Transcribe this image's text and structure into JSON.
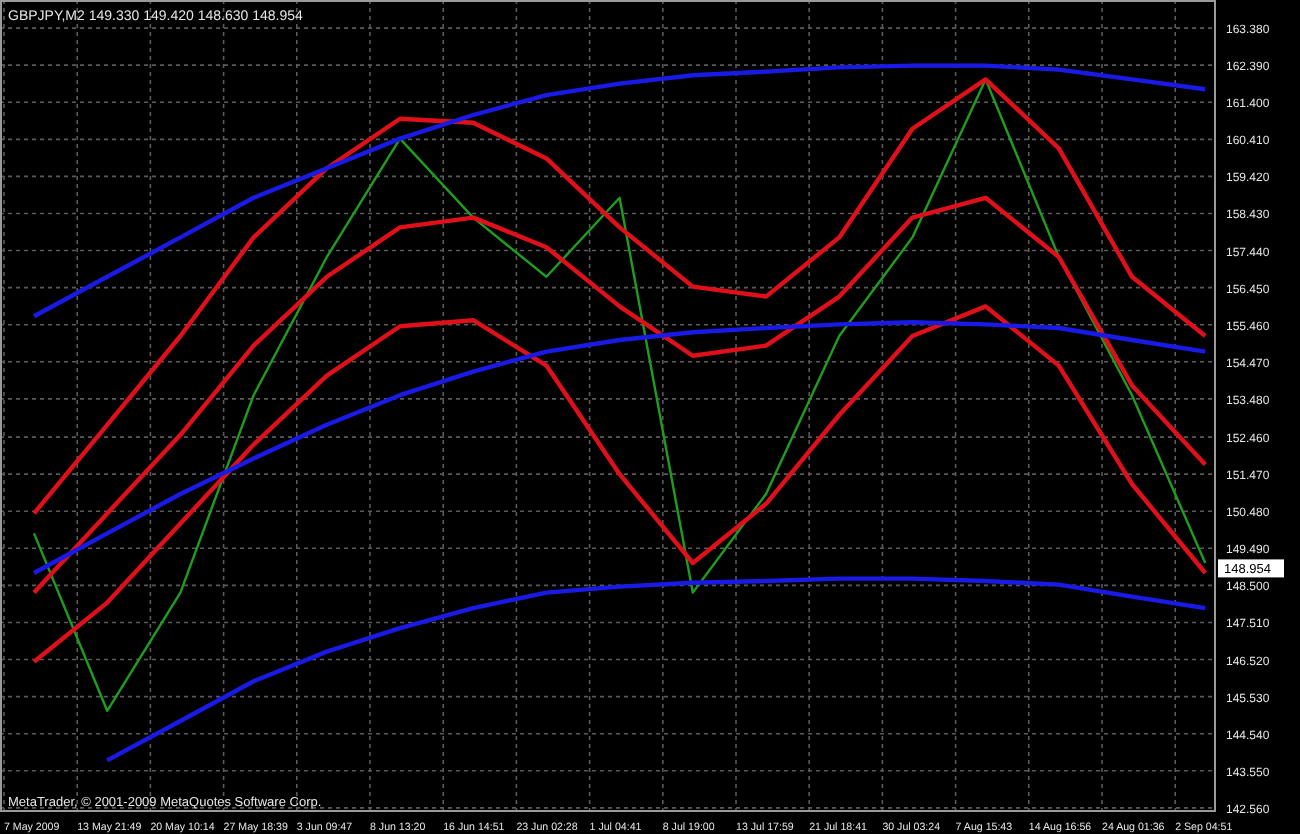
{
  "chart": {
    "title": "GBPJPY,M2 149.330 149.420 148.630 148.954",
    "copyright": "MetaTrader, © 2001-2009 MetaQuotes Software Corp.",
    "current_price": "148.954",
    "chart_data": {
      "type": "line",
      "grid": true,
      "categories": [
        "7 May 2009",
        "13 May 21:49",
        "20 May 10:14",
        "27 May 18:39",
        "3 Jun 09:47",
        "8 Jun 13:20",
        "16 Jun 14:51",
        "23 Jun 02:28",
        "1 Jul 04:41",
        "8 Jul 19:00",
        "13 Jul 17:59",
        "21 Jul 18:41",
        "30 Jul 03:24",
        "7 Aug 15:43",
        "14 Aug 16:56",
        "24 Aug 01:36",
        "2 Sep 04:51"
      ],
      "series": [
        {
          "color": "#1e9e1e",
          "values": [
            149.89,
            145.15,
            148.31,
            153.58,
            157.27,
            160.43,
            158.32,
            156.74,
            158.85,
            148.31,
            150.94,
            155.16,
            157.79,
            162.01,
            157.27,
            153.58,
            149.1
          ]
        },
        {
          "color": "#e0101a",
          "values": [
            150.42,
            152.79,
            155.16,
            157.79,
            159.64,
            160.96,
            160.85,
            159.9,
            158.06,
            156.48,
            156.21,
            157.79,
            160.69,
            162.01,
            160.17,
            156.74,
            155.16
          ]
        },
        {
          "color": "#e0101a",
          "values": [
            148.31,
            150.42,
            152.52,
            154.9,
            156.74,
            158.06,
            158.32,
            157.53,
            155.95,
            154.63,
            154.9,
            156.21,
            158.32,
            158.85,
            157.27,
            153.84,
            151.73
          ]
        },
        {
          "color": "#e0101a",
          "values": [
            146.46,
            148.04,
            150.15,
            152.26,
            154.1,
            155.42,
            155.58,
            154.37,
            151.47,
            149.1,
            150.68,
            153.05,
            155.16,
            155.95,
            154.37,
            151.21,
            148.83
          ]
        },
        {
          "color": "#1a1ae6",
          "values": [
            155.69,
            156.74,
            157.79,
            158.85,
            159.64,
            160.43,
            161.06,
            161.59,
            161.9,
            162.12,
            162.22,
            162.33,
            162.38,
            162.38,
            162.27,
            162.01,
            161.75
          ]
        },
        {
          "color": "#1a1ae6",
          "values": [
            148.83,
            149.89,
            150.94,
            151.89,
            152.79,
            153.58,
            154.21,
            154.74,
            155.05,
            155.26,
            155.37,
            155.47,
            155.53,
            155.47,
            155.37,
            155.05,
            154.74
          ]
        },
        {
          "color": "#1a1ae6",
          "values": [
            null,
            143.83,
            144.88,
            145.94,
            146.73,
            147.36,
            147.89,
            148.31,
            148.47,
            148.57,
            148.62,
            148.68,
            148.68,
            148.62,
            148.52,
            148.2,
            147.89
          ]
        }
      ],
      "ylim": [
        142.45,
        164.13
      ],
      "yticks": [
        {
          "value": 163.38,
          "label": "163.380"
        },
        {
          "value": 162.39,
          "label": "162.390"
        },
        {
          "value": 161.4,
          "label": "161.400"
        },
        {
          "value": 160.41,
          "label": "160.410"
        },
        {
          "value": 159.42,
          "label": "159.420"
        },
        {
          "value": 158.43,
          "label": "158.430"
        },
        {
          "value": 157.44,
          "label": "157.440"
        },
        {
          "value": 156.45,
          "label": "156.450"
        },
        {
          "value": 155.46,
          "label": "155.460"
        },
        {
          "value": 154.47,
          "label": "154.470"
        },
        {
          "value": 153.48,
          "label": "153.480"
        },
        {
          "value": 152.46,
          "label": "152.460"
        },
        {
          "value": 151.47,
          "label": "151.470"
        },
        {
          "value": 150.48,
          "label": "150.480"
        },
        {
          "value": 149.49,
          "label": "149.490"
        },
        {
          "value": 148.5,
          "label": "148.500"
        },
        {
          "value": 147.51,
          "label": "147.510"
        },
        {
          "value": 146.52,
          "label": "146.520"
        },
        {
          "value": 145.53,
          "label": "145.530"
        },
        {
          "value": 144.54,
          "label": "144.540"
        },
        {
          "value": 143.55,
          "label": "143.550"
        },
        {
          "value": 142.56,
          "label": "142.560"
        }
      ]
    }
  }
}
